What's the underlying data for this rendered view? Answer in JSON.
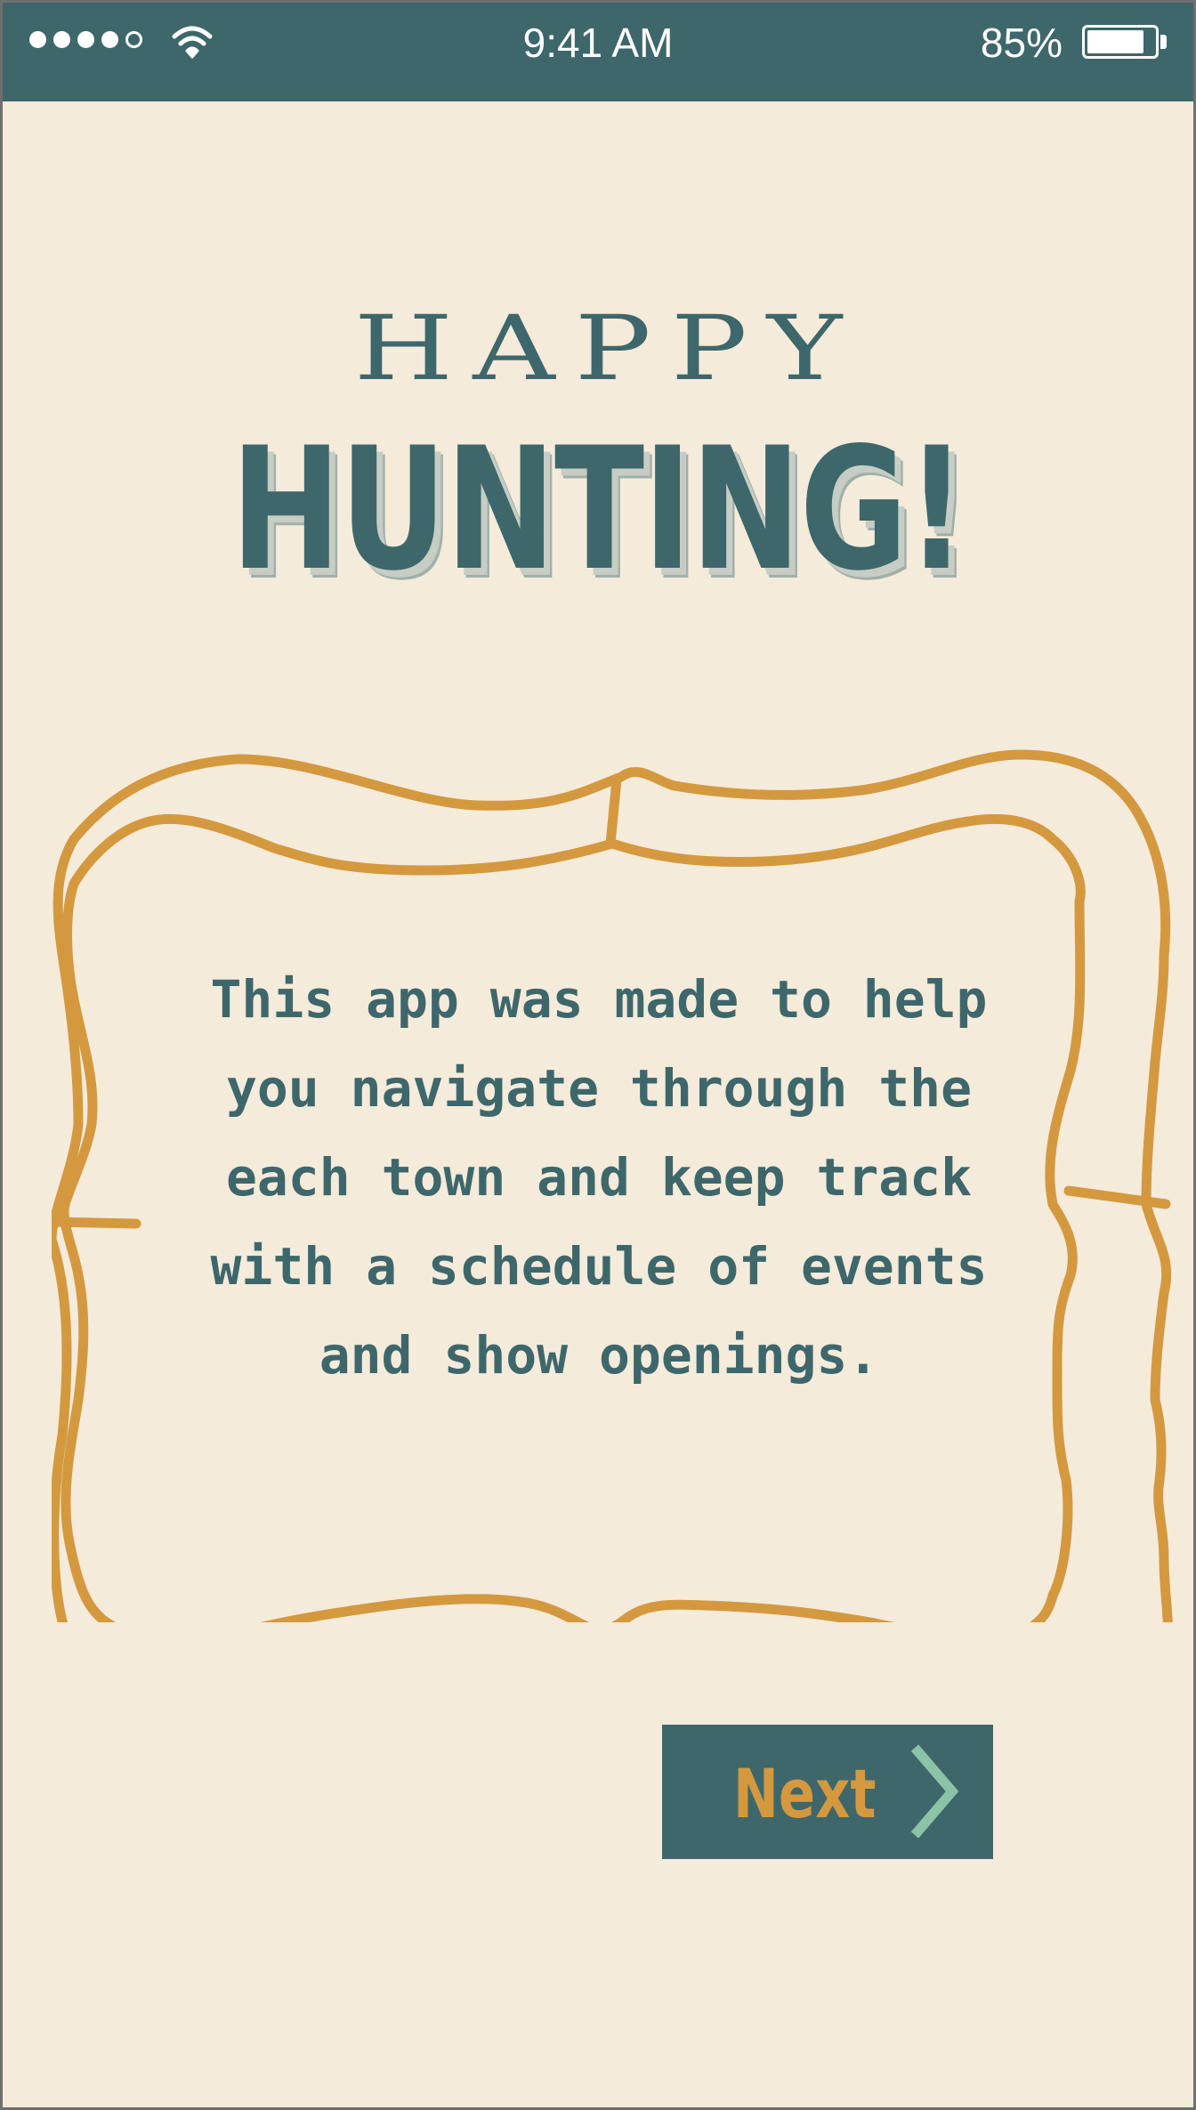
{
  "status_bar": {
    "time": "9:41 AM",
    "battery_percent": "85%",
    "battery_level": 0.85,
    "signal_bars_filled": 4,
    "signal_bars_total": 5,
    "icons": [
      "signal-dots-icon",
      "wifi-icon",
      "battery-icon"
    ]
  },
  "title": {
    "line1": "HAPPY",
    "line2": "HUNTING!"
  },
  "intro": {
    "text": "This app was made to help you navigate through the each town and keep track with a schedule of events and show openings."
  },
  "next_button": {
    "label": "Next",
    "icon": "chevron-right-icon"
  },
  "colors": {
    "background": "#f4ebdb",
    "primary": "#3e676b",
    "accent": "#d4993f",
    "chevron": "#8cc3a6"
  }
}
